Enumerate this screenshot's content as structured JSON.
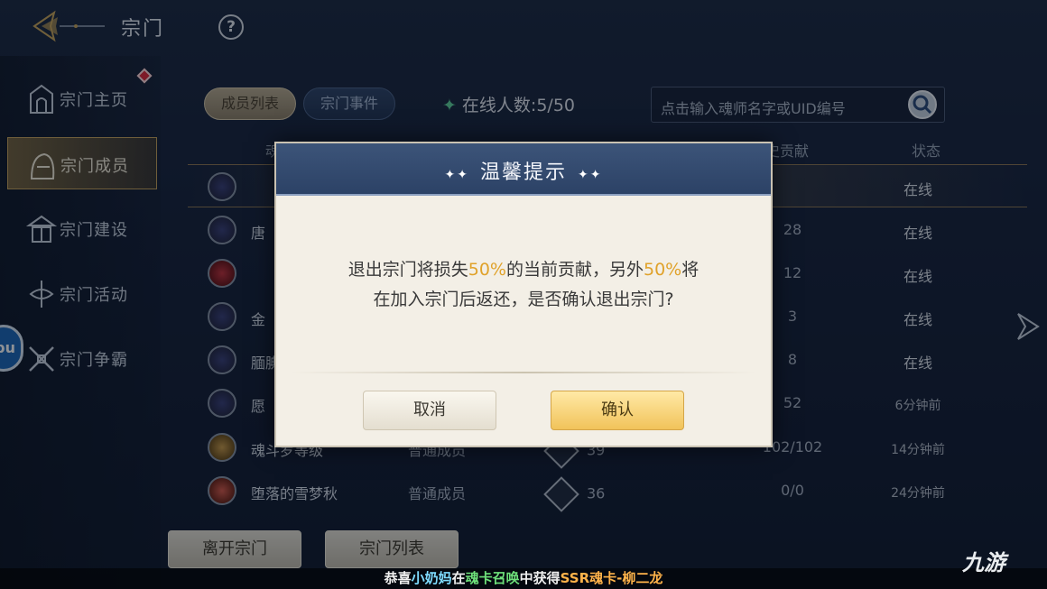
{
  "header": {
    "title": "宗门",
    "help": "?"
  },
  "sidebar": {
    "items": [
      {
        "label": "宗门主页",
        "icon": "sect-hall-icon"
      },
      {
        "label": "宗门成员",
        "icon": "member-icon"
      },
      {
        "label": "宗门建设",
        "icon": "building-icon"
      },
      {
        "label": "宗门活动",
        "icon": "activity-icon"
      },
      {
        "label": "宗门争霸",
        "icon": "crossed-swords-icon"
      }
    ],
    "bubble": "bu"
  },
  "tabs": {
    "members": "成员列表",
    "events": "宗门事件"
  },
  "online": {
    "star": "✦",
    "text": "在线人数:5/50"
  },
  "search": {
    "placeholder": "点击输入魂师名字或UID编号"
  },
  "table": {
    "headers": {
      "name_partial": "魂",
      "contrib_partial": "史贡献",
      "status": "状态"
    },
    "rows": [
      {
        "name": "",
        "position": "",
        "level": "",
        "contrib": "",
        "status": "在线",
        "avatar": "purple",
        "selected": true
      },
      {
        "name": "唐",
        "position": "",
        "level": "",
        "contrib": "28",
        "status": "在线",
        "avatar": "purple"
      },
      {
        "name": "",
        "position": "",
        "level": "",
        "contrib": "12",
        "status": "在线",
        "avatar": "red"
      },
      {
        "name": "金",
        "position": "",
        "level": "",
        "contrib": "3",
        "status": "在线",
        "avatar": "purple"
      },
      {
        "name": "腼腆",
        "position": "",
        "level": "",
        "contrib": "8",
        "status": "在线",
        "avatar": "purple"
      },
      {
        "name": "愿",
        "position": "",
        "level": "",
        "contrib": "52",
        "status": "6分钟前",
        "avatar": "purple"
      },
      {
        "name": "魂斗罗等级",
        "position": "普通成员",
        "level": "39",
        "contrib": "102/102",
        "status": "14分钟前",
        "avatar": "gold"
      },
      {
        "name": "堕落的雪梦秋",
        "position": "普通成员",
        "level": "36",
        "contrib": "0/0",
        "status": "24分钟前",
        "avatar": "ember"
      }
    ]
  },
  "bottom": {
    "leave": "离开宗门",
    "list": "宗门列表"
  },
  "dialog": {
    "title": "温馨提示",
    "deco": "✦✦",
    "msg_p1": "退出宗门将损失",
    "pct1": "50%",
    "msg_p2": "的当前贡献，另外",
    "pct2": "50%",
    "msg_p3": "将",
    "msg_line2": "在加入宗门后返还，是否确认退出宗门?",
    "cancel": "取消",
    "confirm": "确认"
  },
  "ticker": {
    "p1": "恭喜",
    "name": "小奶妈",
    "p2": "在",
    "event": "魂卡召唤",
    "p3": "中获得",
    "reward": "SSR魂卡-柳二龙"
  },
  "watermark": "九游",
  "colors": {
    "accent": "#e0a22a",
    "dialog_header": "#2c4266",
    "confirm_button": "#f1c35a"
  }
}
